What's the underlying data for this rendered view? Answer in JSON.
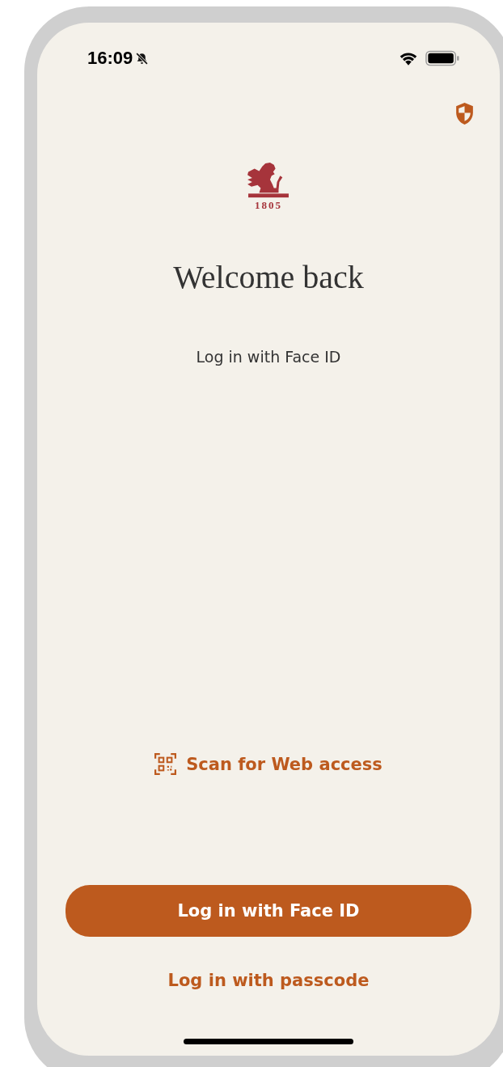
{
  "status_bar": {
    "time": "16:09",
    "silent": true
  },
  "logo": {
    "year": "1805"
  },
  "title": "Welcome back",
  "subtitle": "Log in with Face ID",
  "scan_link": "Scan for Web access",
  "primary_button": "Log in with Face ID",
  "secondary_link": "Log in with passcode"
}
